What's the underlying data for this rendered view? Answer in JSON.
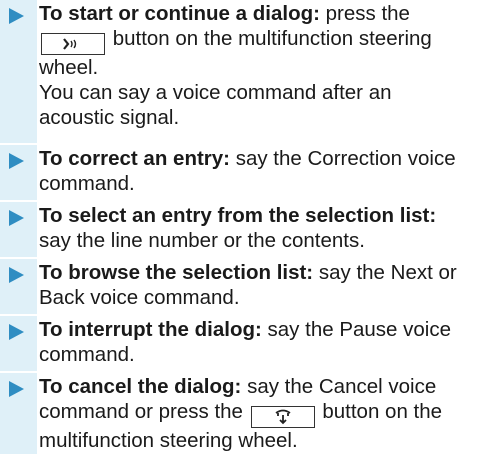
{
  "instructions": [
    {
      "heading": "To start or continue a dialog:",
      "text_before": "press the",
      "button_icon": "voice-control-icon",
      "text_after": "button on the multifunction steering wheel.",
      "continuation": "You can say a voice command after an acoustic signal."
    },
    {
      "heading": "To correct an entry:",
      "text": "say the Correction voice command."
    },
    {
      "heading": "To select an entry from the selection list:",
      "text": "say the line number or the contents."
    },
    {
      "heading": "To browse the selection list:",
      "text": "say the Next or Back voice command."
    },
    {
      "heading": "To interrupt the dialog:",
      "text": "say the Pause voice command."
    },
    {
      "heading": "To cancel the dialog:",
      "text_before": "say the Cancel voice command or press the",
      "button_icon": "hang-up-icon",
      "text_after": "button on the multifunction steering wheel."
    }
  ],
  "colors": {
    "marker": "#2f8dc2",
    "marker_band": "#dff0f8",
    "text": "#1a1a1a"
  }
}
